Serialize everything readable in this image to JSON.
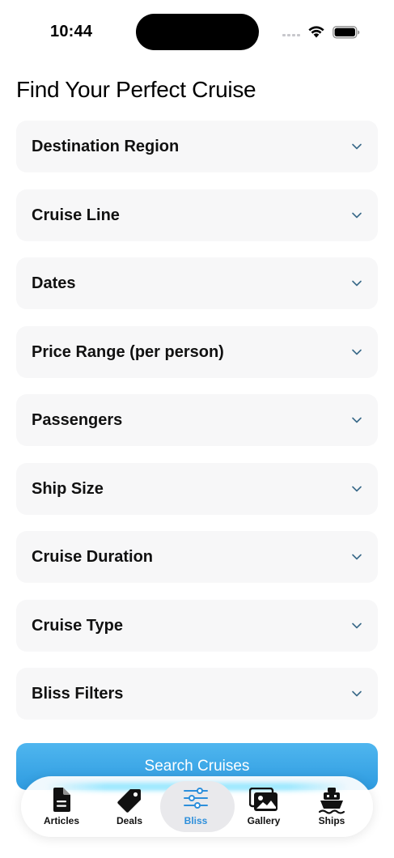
{
  "status": {
    "time": "10:44"
  },
  "header": {
    "title": "Find Your Perfect Cruise"
  },
  "filters": [
    {
      "label": "Destination Region"
    },
    {
      "label": "Cruise Line"
    },
    {
      "label": "Dates"
    },
    {
      "label": "Price Range (per person)"
    },
    {
      "label": "Passengers"
    },
    {
      "label": "Ship Size"
    },
    {
      "label": "Cruise Duration"
    },
    {
      "label": "Cruise Type"
    },
    {
      "label": "Bliss Filters"
    }
  ],
  "search": {
    "label": "Search Cruises"
  },
  "tabs": [
    {
      "label": "Articles",
      "icon": "document-icon"
    },
    {
      "label": "Deals",
      "icon": "tag-icon"
    },
    {
      "label": "Bliss",
      "icon": "sliders-icon",
      "active": true
    },
    {
      "label": "Gallery",
      "icon": "photos-icon"
    },
    {
      "label": "Ships",
      "icon": "ship-icon"
    }
  ],
  "colors": {
    "accent": "#2d8fdb",
    "row_background": "#f7f7f8",
    "chevron": "#3a6a8a"
  }
}
